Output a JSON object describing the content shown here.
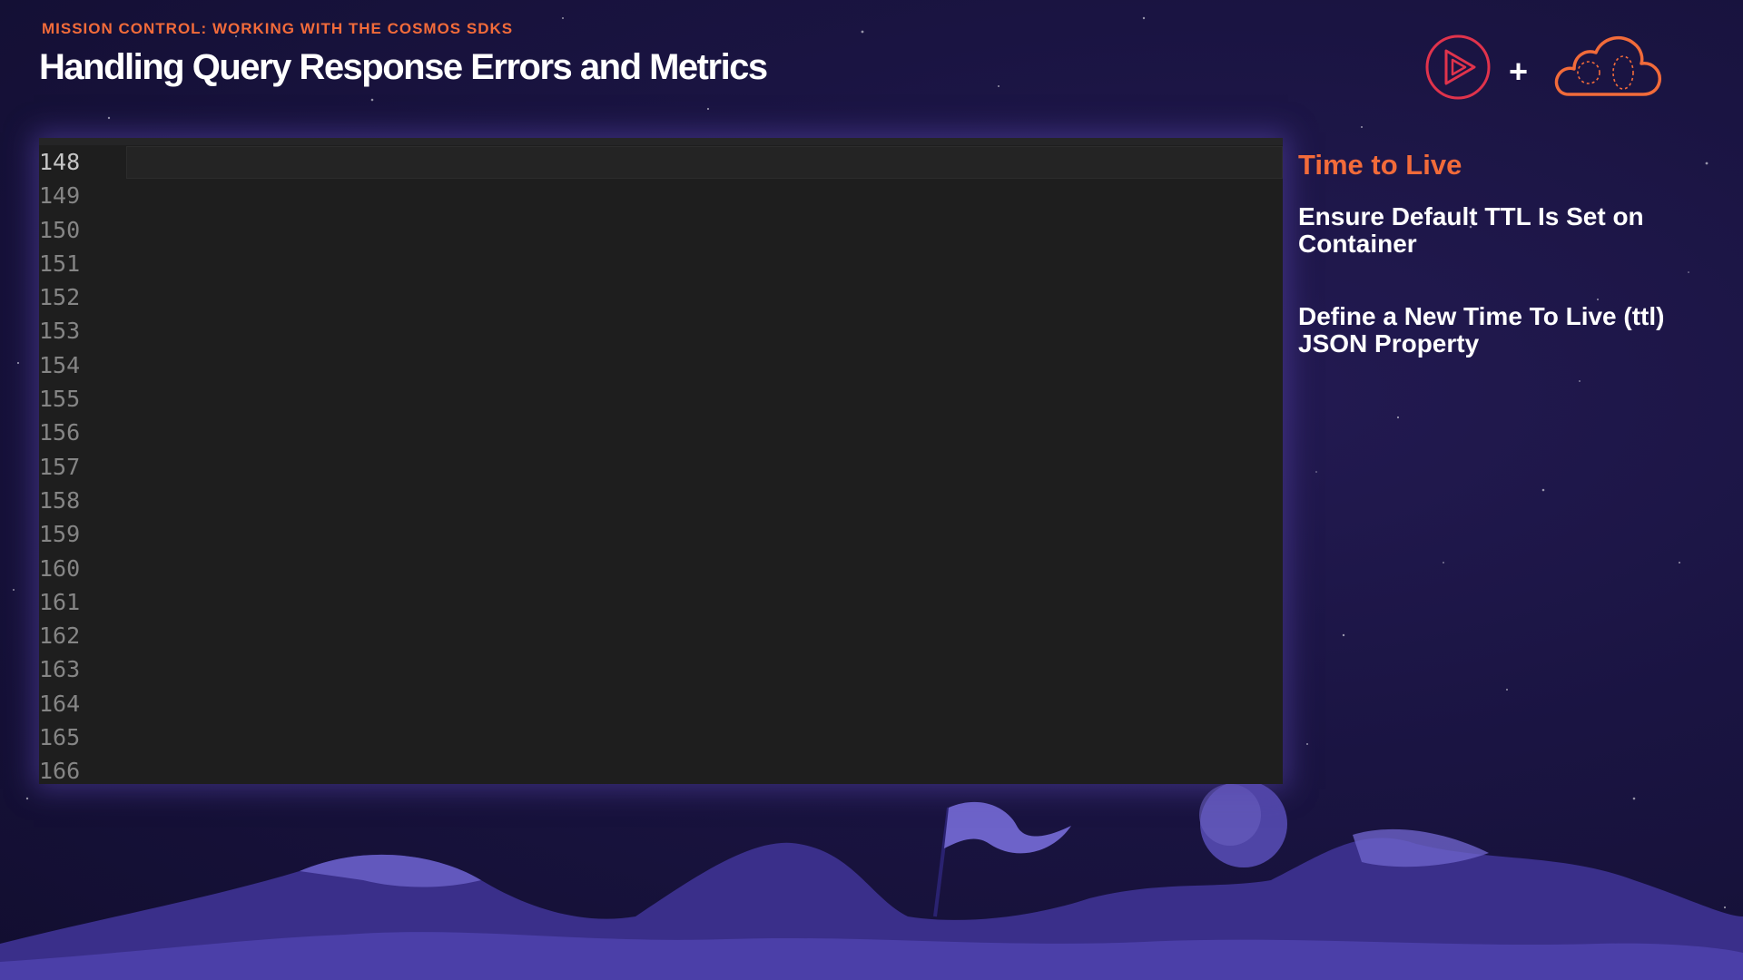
{
  "header": {
    "kicker": "MISSION CONTROL: WORKING WITH THE COSMOS SDKS",
    "title": "Handling Query Response Errors and Metrics"
  },
  "logos": {
    "play_icon": "play-logo-icon",
    "plus": "+",
    "cloud_icon": "cloud-logo-icon"
  },
  "editor": {
    "line_numbers": [
      "148",
      "149",
      "150",
      "151",
      "152",
      "153",
      "154",
      "155",
      "156",
      "157",
      "158",
      "159",
      "160",
      "161",
      "162",
      "163",
      "164",
      "165",
      "166"
    ],
    "active_line": "148"
  },
  "sidebar": {
    "heading": "Time to Live",
    "items": [
      "Ensure Default TTL Is Set on Container",
      "Define a New Time To Live (ttl) JSON Property"
    ]
  },
  "colors": {
    "accent": "#f26b3a",
    "background": "#17123a",
    "editor": "#1e1e1e",
    "play_logo": "#e0334c"
  }
}
